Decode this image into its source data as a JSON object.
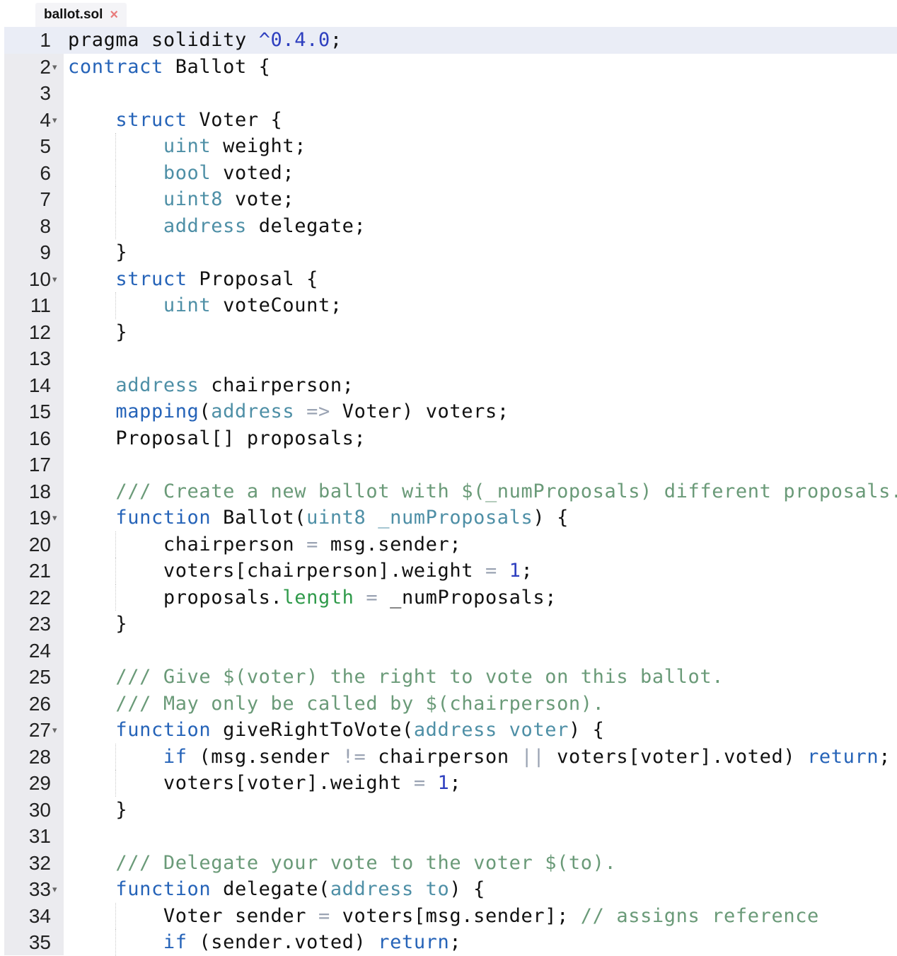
{
  "tab": {
    "title": "ballot.sol",
    "close_glyph": "×"
  },
  "editor": {
    "language": "solidity",
    "active_line": 1,
    "lines": [
      {
        "n": "1",
        "fold": false,
        "guides": 0,
        "tokens": [
          [
            "",
            "pragma solidity "
          ],
          [
            "num",
            "^0.4.0"
          ],
          [
            "",
            ";"
          ]
        ]
      },
      {
        "n": "2",
        "fold": true,
        "guides": 0,
        "tokens": [
          [
            "kw",
            "contract"
          ],
          [
            "",
            " Ballot {"
          ]
        ]
      },
      {
        "n": "3",
        "fold": false,
        "guides": 0,
        "tokens": []
      },
      {
        "n": "4",
        "fold": true,
        "guides": 0,
        "tokens": [
          [
            "",
            "    "
          ],
          [
            "kw",
            "struct"
          ],
          [
            "",
            " Voter {"
          ]
        ]
      },
      {
        "n": "5",
        "fold": false,
        "guides": 1,
        "tokens": [
          [
            "",
            "        "
          ],
          [
            "ty",
            "uint"
          ],
          [
            "",
            " weight;"
          ]
        ]
      },
      {
        "n": "6",
        "fold": false,
        "guides": 1,
        "tokens": [
          [
            "",
            "        "
          ],
          [
            "ty",
            "bool"
          ],
          [
            "",
            " voted;"
          ]
        ]
      },
      {
        "n": "7",
        "fold": false,
        "guides": 1,
        "tokens": [
          [
            "",
            "        "
          ],
          [
            "ty",
            "uint8"
          ],
          [
            "",
            " vote;"
          ]
        ]
      },
      {
        "n": "8",
        "fold": false,
        "guides": 1,
        "tokens": [
          [
            "",
            "        "
          ],
          [
            "ty",
            "address"
          ],
          [
            "",
            " delegate;"
          ]
        ]
      },
      {
        "n": "9",
        "fold": false,
        "guides": 0,
        "tokens": [
          [
            "",
            "    }"
          ]
        ]
      },
      {
        "n": "10",
        "fold": true,
        "guides": 0,
        "tokens": [
          [
            "",
            "    "
          ],
          [
            "kw",
            "struct"
          ],
          [
            "",
            " Proposal {"
          ]
        ]
      },
      {
        "n": "11",
        "fold": false,
        "guides": 1,
        "tokens": [
          [
            "",
            "        "
          ],
          [
            "ty",
            "uint"
          ],
          [
            "",
            " voteCount;"
          ]
        ]
      },
      {
        "n": "12",
        "fold": false,
        "guides": 0,
        "tokens": [
          [
            "",
            "    }"
          ]
        ]
      },
      {
        "n": "13",
        "fold": false,
        "guides": 0,
        "tokens": []
      },
      {
        "n": "14",
        "fold": false,
        "guides": 0,
        "tokens": [
          [
            "",
            "    "
          ],
          [
            "ty",
            "address"
          ],
          [
            "",
            " chairperson;"
          ]
        ]
      },
      {
        "n": "15",
        "fold": false,
        "guides": 0,
        "tokens": [
          [
            "",
            "    "
          ],
          [
            "kw",
            "mapping"
          ],
          [
            "",
            "("
          ],
          [
            "ty",
            "address"
          ],
          [
            "",
            " "
          ],
          [
            "op",
            "=>"
          ],
          [
            "",
            " Voter) voters;"
          ]
        ]
      },
      {
        "n": "16",
        "fold": false,
        "guides": 0,
        "tokens": [
          [
            "",
            "    Proposal[] proposals;"
          ]
        ]
      },
      {
        "n": "17",
        "fold": false,
        "guides": 0,
        "tokens": []
      },
      {
        "n": "18",
        "fold": false,
        "guides": 0,
        "tokens": [
          [
            "",
            "    "
          ],
          [
            "cm",
            "/// Create a new ballot with $(_numProposals) different proposals."
          ]
        ]
      },
      {
        "n": "19",
        "fold": true,
        "guides": 0,
        "tokens": [
          [
            "",
            "    "
          ],
          [
            "kw",
            "function"
          ],
          [
            "",
            " Ballot("
          ],
          [
            "ty",
            "uint8 _numProposals"
          ],
          [
            "",
            ") {"
          ]
        ]
      },
      {
        "n": "20",
        "fold": false,
        "guides": 1,
        "tokens": [
          [
            "",
            "        chairperson "
          ],
          [
            "op",
            "="
          ],
          [
            "",
            " msg.sender;"
          ]
        ]
      },
      {
        "n": "21",
        "fold": false,
        "guides": 1,
        "tokens": [
          [
            "",
            "        voters[chairperson].weight "
          ],
          [
            "op",
            "="
          ],
          [
            "",
            " "
          ],
          [
            "num",
            "1"
          ],
          [
            "",
            ";"
          ]
        ]
      },
      {
        "n": "22",
        "fold": false,
        "guides": 1,
        "tokens": [
          [
            "",
            "        proposals."
          ],
          [
            "prop",
            "length"
          ],
          [
            "",
            " "
          ],
          [
            "op",
            "="
          ],
          [
            "",
            " _numProposals;"
          ]
        ]
      },
      {
        "n": "23",
        "fold": false,
        "guides": 0,
        "tokens": [
          [
            "",
            "    }"
          ]
        ]
      },
      {
        "n": "24",
        "fold": false,
        "guides": 0,
        "tokens": []
      },
      {
        "n": "25",
        "fold": false,
        "guides": 0,
        "tokens": [
          [
            "",
            "    "
          ],
          [
            "cm",
            "/// Give $(voter) the right to vote on this ballot."
          ]
        ]
      },
      {
        "n": "26",
        "fold": false,
        "guides": 0,
        "tokens": [
          [
            "",
            "    "
          ],
          [
            "cm",
            "/// May only be called by $(chairperson)."
          ]
        ]
      },
      {
        "n": "27",
        "fold": true,
        "guides": 0,
        "tokens": [
          [
            "",
            "    "
          ],
          [
            "kw",
            "function"
          ],
          [
            "",
            " giveRightToVote("
          ],
          [
            "ty",
            "address voter"
          ],
          [
            "",
            ") {"
          ]
        ]
      },
      {
        "n": "28",
        "fold": false,
        "guides": 1,
        "tokens": [
          [
            "",
            "        "
          ],
          [
            "kw",
            "if"
          ],
          [
            "",
            " (msg.sender "
          ],
          [
            "op",
            "!="
          ],
          [
            "",
            " chairperson "
          ],
          [
            "op",
            "||"
          ],
          [
            "",
            " voters[voter].voted) "
          ],
          [
            "kw",
            "return"
          ],
          [
            "",
            ";"
          ]
        ]
      },
      {
        "n": "29",
        "fold": false,
        "guides": 1,
        "tokens": [
          [
            "",
            "        voters[voter].weight "
          ],
          [
            "op",
            "="
          ],
          [
            "",
            " "
          ],
          [
            "num",
            "1"
          ],
          [
            "",
            ";"
          ]
        ]
      },
      {
        "n": "30",
        "fold": false,
        "guides": 0,
        "tokens": [
          [
            "",
            "    }"
          ]
        ]
      },
      {
        "n": "31",
        "fold": false,
        "guides": 0,
        "tokens": []
      },
      {
        "n": "32",
        "fold": false,
        "guides": 0,
        "tokens": [
          [
            "",
            "    "
          ],
          [
            "cm",
            "/// Delegate your vote to the voter $(to)."
          ]
        ]
      },
      {
        "n": "33",
        "fold": true,
        "guides": 0,
        "tokens": [
          [
            "",
            "    "
          ],
          [
            "kw",
            "function"
          ],
          [
            "",
            " delegate("
          ],
          [
            "ty",
            "address to"
          ],
          [
            "",
            ") {"
          ]
        ]
      },
      {
        "n": "34",
        "fold": false,
        "guides": 1,
        "tokens": [
          [
            "",
            "        Voter sender "
          ],
          [
            "op",
            "="
          ],
          [
            "",
            " voters[msg.sender]; "
          ],
          [
            "cm",
            "// assigns reference"
          ]
        ]
      },
      {
        "n": "35",
        "fold": false,
        "guides": 1,
        "tokens": [
          [
            "",
            "        "
          ],
          [
            "kw",
            "if"
          ],
          [
            "",
            " (sender.voted) "
          ],
          [
            "kw",
            "return"
          ],
          [
            "",
            ";"
          ]
        ]
      }
    ]
  },
  "colors": {
    "keyword": "#2563b8",
    "type": "#4e8fa6",
    "number": "#2e3fbf",
    "comment": "#6a9a78",
    "operator": "#9aa3b3",
    "property": "#2f9a4a",
    "gutter_bg": "#ebebef",
    "active_line_bg": "#eaedf6",
    "tab_close": "#e87b7b"
  }
}
